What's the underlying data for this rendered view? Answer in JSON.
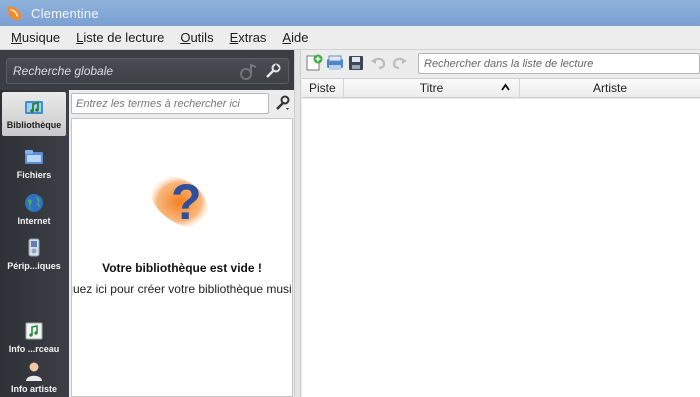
{
  "window": {
    "title": "Clementine"
  },
  "menu": [
    {
      "key": "musique",
      "mnemonic": "M",
      "rest": "usique"
    },
    {
      "key": "liste",
      "mnemonic": "L",
      "rest": "iste de lecture"
    },
    {
      "key": "outils",
      "mnemonic": "O",
      "rest": "utils"
    },
    {
      "key": "extras",
      "mnemonic": "E",
      "rest": "xtras"
    },
    {
      "key": "aide",
      "mnemonic": "A",
      "rest": "ide"
    }
  ],
  "global_search": {
    "placeholder": "Recherche globale"
  },
  "tabs": [
    {
      "label": "Bibliothèque",
      "icon": "library-icon",
      "active": true
    },
    {
      "label": "Fichiers",
      "icon": "files-icon",
      "active": false
    },
    {
      "label": "Internet",
      "icon": "globe-icon",
      "active": false
    },
    {
      "label": "Périp...iques",
      "icon": "devices-icon",
      "active": false
    },
    {
      "label": "Info ...rceau",
      "icon": "song-info-icon",
      "active": false
    },
    {
      "label": "Info artiste",
      "icon": "artist-icon",
      "active": false
    }
  ],
  "library": {
    "filter_placeholder": "Entrez les termes à rechercher ici",
    "empty_title": "Votre bibliothèque est vide !",
    "empty_hint": "Cliquez ici pour créer votre bibliothèque musicale"
  },
  "playlist": {
    "search_placeholder": "Rechercher dans la liste de lecture",
    "columns": {
      "piste": "Piste",
      "titre": "Titre",
      "artiste": "Artiste"
    }
  },
  "colors": {
    "titlebar": "#7aa0d2",
    "sidebar": "#3a3d42",
    "accent_orange": "#f08a3a",
    "question_blue": "#2d4f9c"
  }
}
